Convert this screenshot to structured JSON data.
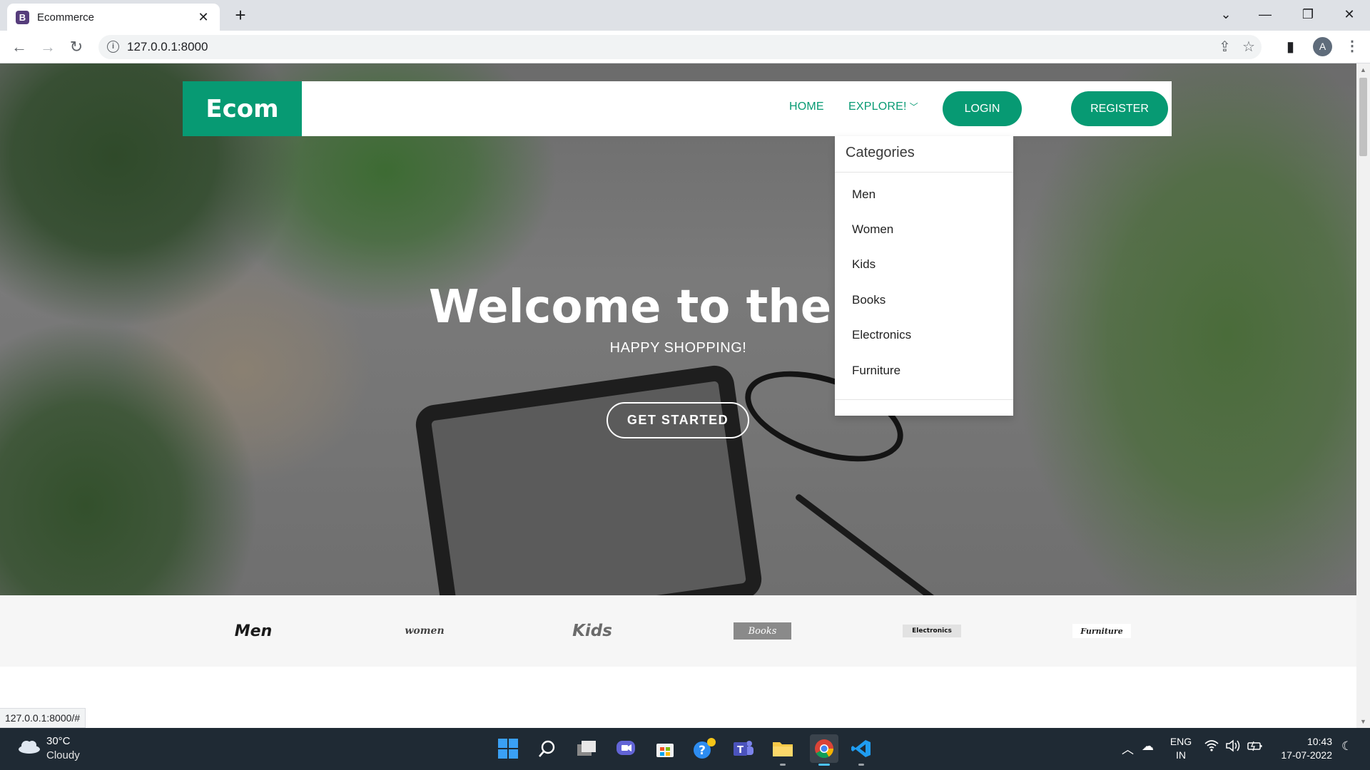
{
  "browser": {
    "tab_title": "Ecommerce",
    "favicon_letter": "B",
    "url": "127.0.0.1:8000",
    "profile_initial": "A",
    "status_url": "127.0.0.1:8000/#"
  },
  "site": {
    "brand": "Ecom",
    "nav": {
      "home": "HOME",
      "explore": "EXPLORE!",
      "login": "LOGIN",
      "register": "REGISTER"
    },
    "dropdown": {
      "header": "Categories",
      "items": [
        "Men",
        "Women",
        "Kids",
        "Books",
        "Electronics",
        "Furniture"
      ]
    },
    "hero": {
      "title": "Welcome to the sto",
      "subtitle": "HAPPY SHOPPING!",
      "cta": "GET STARTED"
    },
    "category_logos": [
      "Men",
      "women",
      "Kids",
      "Books",
      "Electronics",
      "Furniture"
    ]
  },
  "taskbar": {
    "temperature": "30°C",
    "condition": "Cloudy",
    "lang_top": "ENG",
    "lang_bottom": "IN",
    "time": "10:43",
    "date": "17-07-2022"
  },
  "colors": {
    "accent": "#079a73",
    "taskbar": "#1f2a34"
  }
}
